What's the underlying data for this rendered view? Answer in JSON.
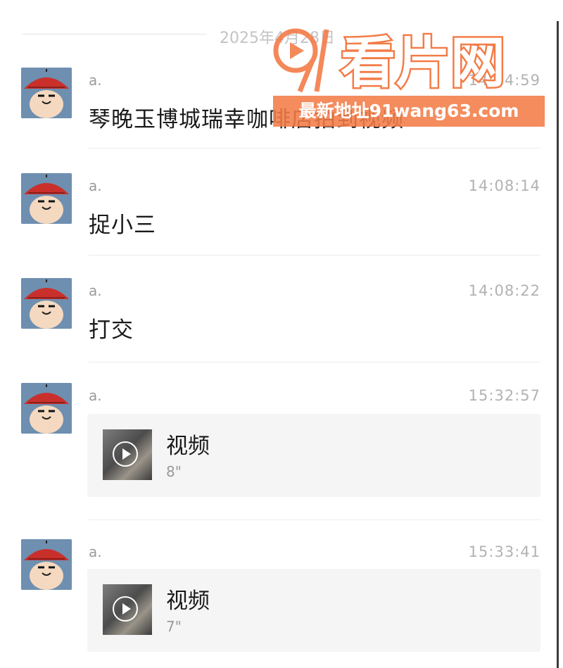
{
  "date_separator": "2025年4月28日",
  "messages": [
    {
      "sender": "a.",
      "time": "14:04:59",
      "text": "琴晚玉博城瑞幸咖啡店拍到视频"
    },
    {
      "sender": "a.",
      "time": "14:08:14",
      "text": "捉小三"
    },
    {
      "sender": "a.",
      "time": "14:08:22",
      "text": "打交"
    },
    {
      "sender": "a.",
      "time": "15:32:57",
      "video": {
        "title": "视频",
        "duration": "8\""
      }
    },
    {
      "sender": "a.",
      "time": "15:33:41",
      "video": {
        "title": "视频",
        "duration": "7\""
      }
    }
  ],
  "watermark": {
    "logo_text": "91看片网",
    "strip_text": "最新地址91wang63.com",
    "color": "#f37c48"
  },
  "icons": {
    "avatar": "cartoon-boy-hat-avatar",
    "video": "play-circle-icon"
  }
}
